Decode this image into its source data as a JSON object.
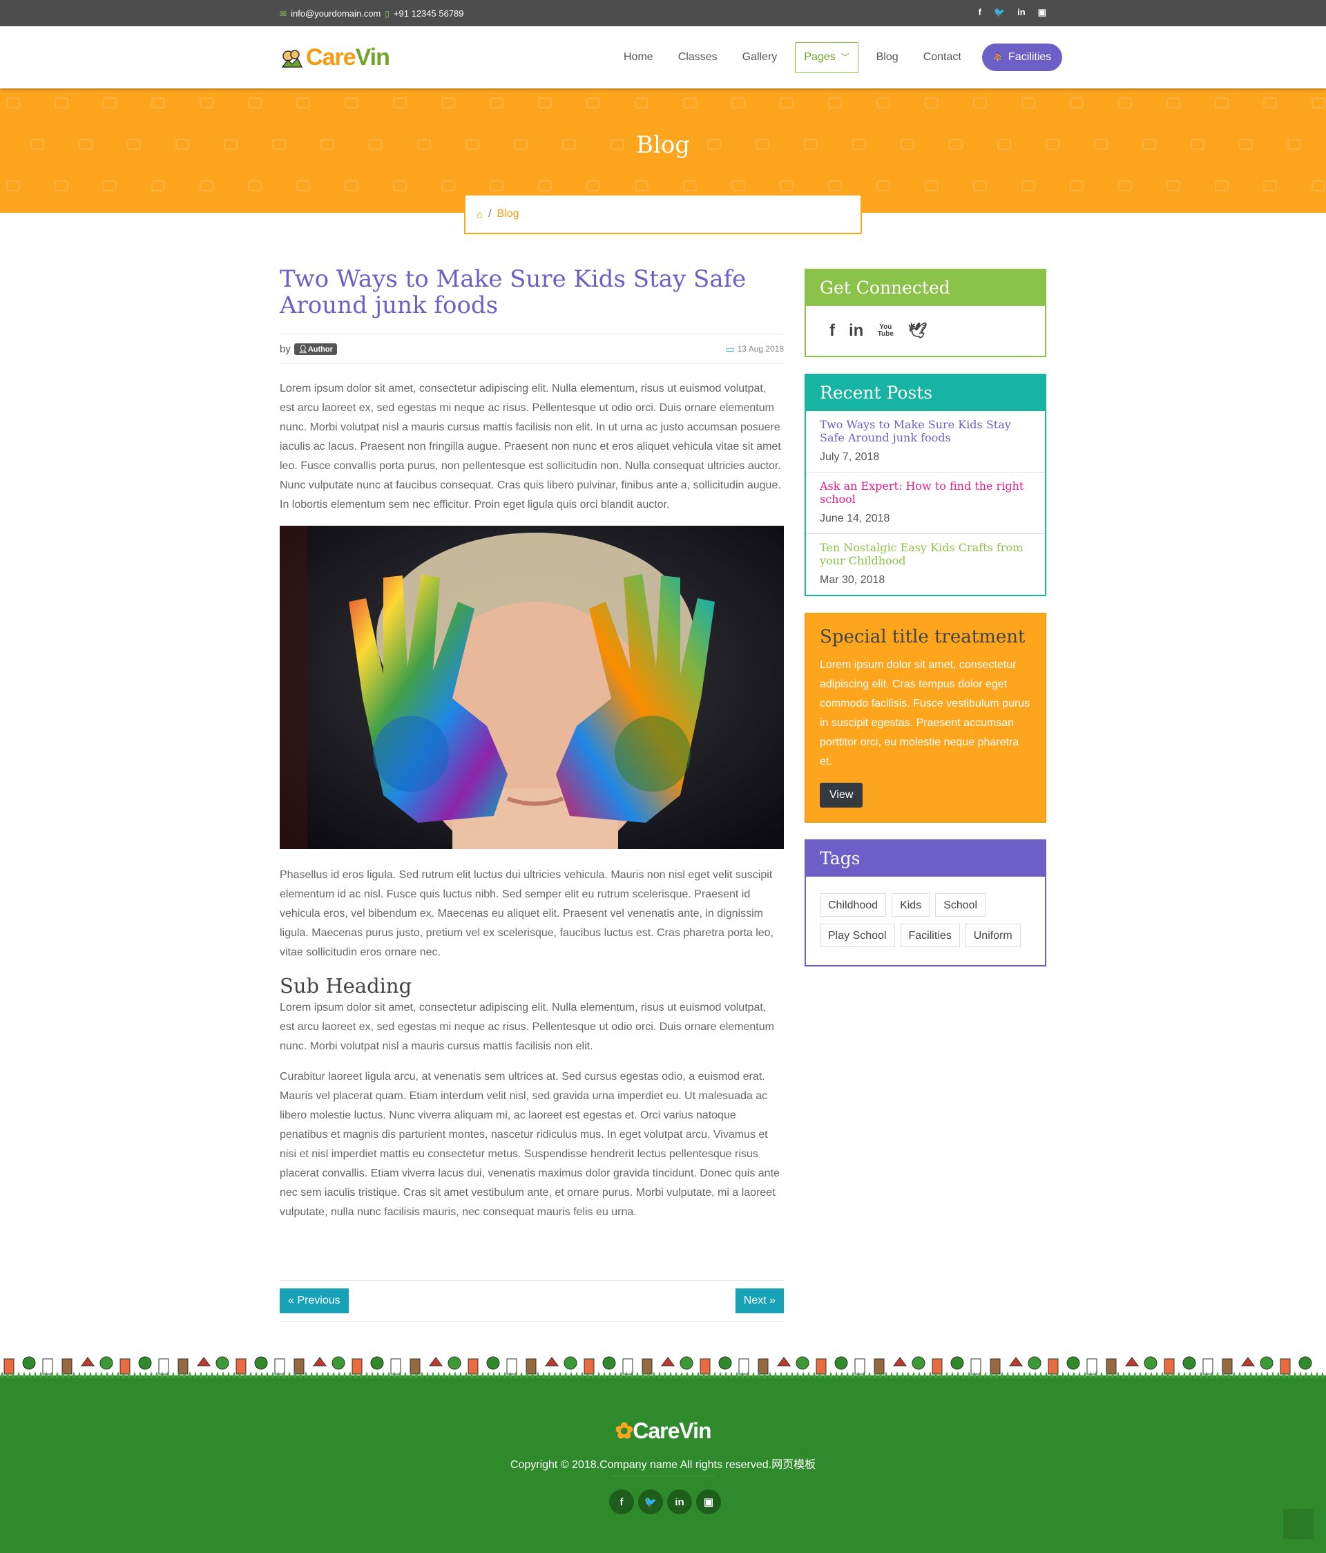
{
  "topbar": {
    "email": "info@yourdomain.com",
    "phone": "+91 12345 56789",
    "social": [
      "f",
      "t",
      "in",
      "yt"
    ]
  },
  "header": {
    "logo_part1": "Care",
    "logo_part2": "Vin",
    "nav": [
      "Home",
      "Classes",
      "Gallery",
      "Pages",
      "Blog",
      "Contact"
    ],
    "cta": "Facilities"
  },
  "banner": {
    "title": "Blog",
    "breadcrumb_current": "Blog",
    "breadcrumb_sep": "/"
  },
  "post": {
    "title": "Two Ways to Make Sure Kids Stay Safe Around junk foods",
    "by": "by",
    "author": "Author",
    "date": "13 Aug 2018",
    "p1": "Lorem ipsum dolor sit amet, consectetur adipiscing elit. Nulla elementum, risus ut euismod volutpat, est arcu laoreet ex, sed egestas mi neque ac risus. Pellentesque ut odio orci. Duis ornare elementum nunc. Morbi volutpat nisl a mauris cursus mattis facilisis non elit. In ut urna ac justo accumsan posuere iaculis ac lacus. Praesent non fringilla augue. Praesent non nunc et eros aliquet vehicula vitae sit amet leo. Fusce convallis porta purus, non pellentesque est sollicitudin non. Nulla consequat ultricies auctor. Nunc vulputate nunc at faucibus consequat. Cras quis libero pulvinar, finibus ante a, sollicitudin augue. In lobortis elementum sem nec efficitur. Proin eget ligula quis orci blandit auctor.",
    "p2": "Phasellus id eros ligula. Sed rutrum elit luctus dui ultricies vehicula. Mauris non nisl eget velit suscipit elementum id ac nisl. Fusce quis luctus nibh. Sed semper elit eu rutrum scelerisque. Praesent id vehicula eros, vel bibendum ex. Maecenas eu aliquet elit. Praesent vel venenatis ante, in dignissim ligula. Maecenas purus justo, pretium vel ex scelerisque, faucibus luctus est. Cras pharetra porta leo, vitae sollicitudin eros ornare nec.",
    "sub_heading": "Sub Heading",
    "p3": "Lorem ipsum dolor sit amet, consectetur adipiscing elit. Nulla elementum, risus ut euismod volutpat, est arcu laoreet ex, sed egestas mi neque ac risus. Pellentesque ut odio orci. Duis ornare elementum nunc. Morbi volutpat nisl a mauris cursus mattis facilisis non elit.",
    "p4": "Curabitur laoreet ligula arcu, at venenatis sem ultrices at. Sed cursus egestas odio, a euismod erat. Mauris vel placerat quam. Etiam interdum velit nisl, sed gravida urna imperdiet eu. Ut malesuada ac libero molestie luctus. Nunc viverra aliquam mi, ac laoreet est egestas et. Orci varius natoque penatibus et magnis dis parturient montes, nascetur ridiculus mus. In eget volutpat arcu. Vivamus et nisi et nisl imperdiet mattis eu consectetur metus. Suspendisse hendrerit lectus pellentesque risus placerat convallis. Etiam viverra lacus dui, venenatis maximus dolor gravida tincidunt. Donec quis ante nec sem iaculis tristique. Cras sit amet vestibulum ante, et ornare purus. Morbi vulputate, mi a laoreet vulputate, nulla nunc facilisis mauris, nec consequat mauris felis eu urna.",
    "prev": "Previous",
    "next": "Next"
  },
  "sidebar": {
    "connect": {
      "title": "Get Connected",
      "icons": [
        "f",
        "in",
        "You Tube",
        "twitter"
      ]
    },
    "recent": {
      "title": "Recent Posts",
      "posts": [
        {
          "title": "Two Ways to Make Sure Kids Stay Safe Around junk foods",
          "date": "July 7, 2018",
          "color": "#6c5fc7"
        },
        {
          "title": "Ask an Expert: How to find the right school",
          "date": "June 14, 2018",
          "color": "#e91e8c"
        },
        {
          "title": "Ten Nostalgic Easy Kids Crafts from your Childhood",
          "date": "Mar 30, 2018",
          "color": "#8bc34a"
        }
      ]
    },
    "special": {
      "title": "Special title treatment",
      "text": "Lorem ipsum dolor sit amet, consectetur adipiscing elit. Cras tempus dolor eget commodo facilisis. Fusce vestibulum purus in suscipit egestas. Praesent accumsan porttitor orci, eu molestie neque pharetra et.",
      "button": "View"
    },
    "tags": {
      "title": "Tags",
      "items": [
        "Childhood",
        "Kids",
        "School",
        "Play School",
        "Facilities",
        "Uniform"
      ]
    }
  },
  "footer": {
    "logo_part1": "Care",
    "logo_part2": "Vin",
    "copyright": "Copyright © 2018.Company name All rights reserved.网页模板",
    "social": [
      "f",
      "t",
      "in",
      "yt"
    ]
  },
  "colors": {
    "brand_orange": "#fda51d",
    "brand_purple": "#6c5fc7",
    "brand_green": "#8bc34a",
    "teal": "#17b3a3",
    "footer_green": "#2f8a2b"
  }
}
